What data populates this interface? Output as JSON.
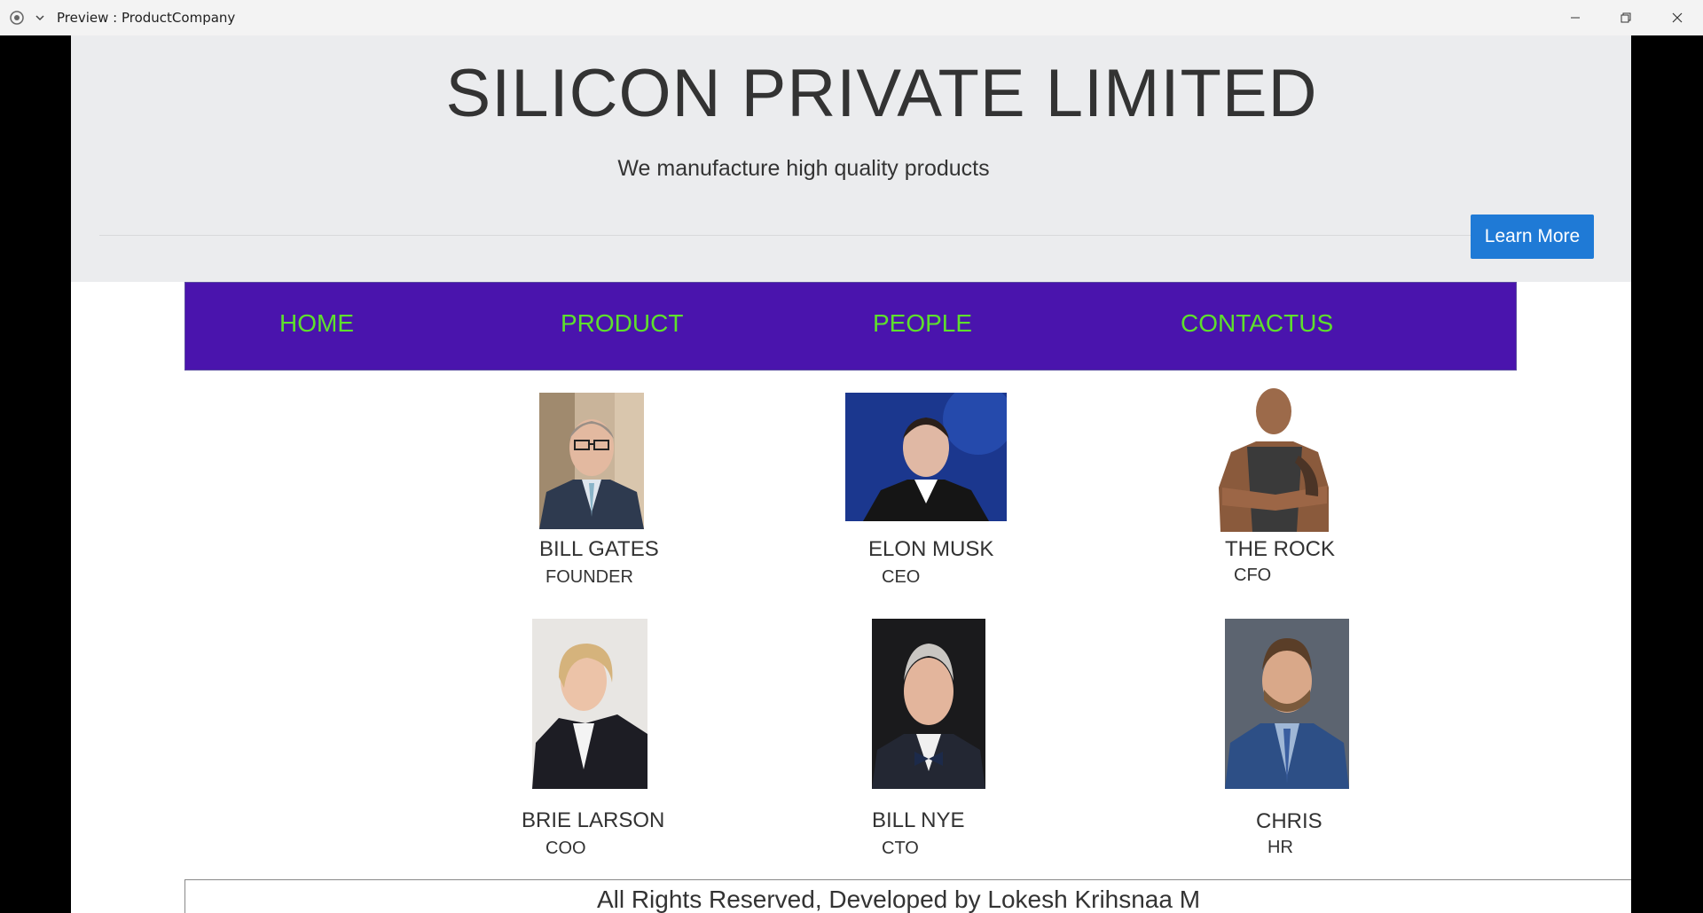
{
  "window": {
    "title": "Preview : ProductCompany"
  },
  "header": {
    "title": "SILICON PRIVATE LIMITED",
    "subtitle": "We manufacture high quality products",
    "learn_more_label": "Learn More",
    "accent_color": "#1f7ad6",
    "background_color": "#ebecee"
  },
  "nav": {
    "background_color": "#4a14ad",
    "text_color": "#5ee02c",
    "items": [
      {
        "label": "HOME"
      },
      {
        "label": "PRODUCT"
      },
      {
        "label": "PEOPLE"
      },
      {
        "label": "CONTACTUS"
      }
    ]
  },
  "people": [
    {
      "name": "BILL GATES",
      "role": "FOUNDER"
    },
    {
      "name": "ELON MUSK",
      "role": "CEO"
    },
    {
      "name": "THE ROCK",
      "role": "CFO"
    },
    {
      "name": "BRIE LARSON",
      "role": "COO"
    },
    {
      "name": "BILL NYE",
      "role": "CTO"
    },
    {
      "name": "CHRIS",
      "role": "HR"
    }
  ],
  "footer": {
    "text": "All Rights Reserved, Developed by Lokesh Krihsnaa M"
  }
}
